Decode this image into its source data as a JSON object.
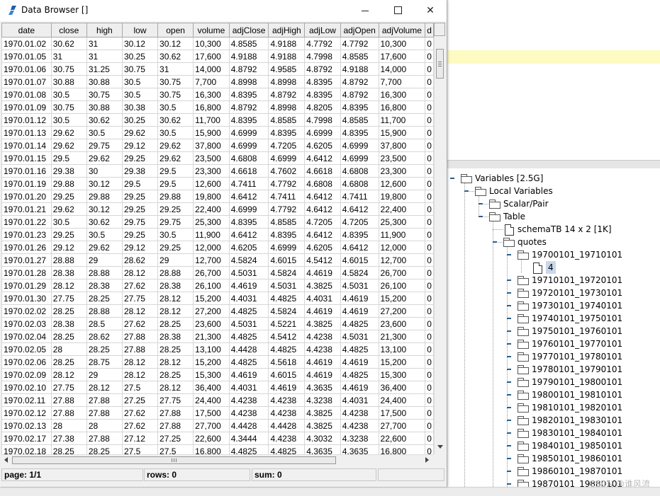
{
  "window": {
    "title": "Data Browser []",
    "minimize_label": "",
    "close_label": "✕"
  },
  "table": {
    "columns": [
      "date",
      "close",
      "high",
      "low",
      "open",
      "volume",
      "adjClose",
      "adjHigh",
      "adjLow",
      "adjOpen",
      "adjVolume",
      "d"
    ],
    "rows": [
      [
        "1970.01.02",
        "30.62",
        "31",
        "30.12",
        "30.12",
        "10,300",
        "4.8585",
        "4.9188",
        "4.7792",
        "4.7792",
        "10,300",
        "0"
      ],
      [
        "1970.01.05",
        "31",
        "31",
        "30.25",
        "30.62",
        "17,600",
        "4.9188",
        "4.9188",
        "4.7998",
        "4.8585",
        "17,600",
        "0"
      ],
      [
        "1970.01.06",
        "30.75",
        "31.25",
        "30.75",
        "31",
        "14,000",
        "4.8792",
        "4.9585",
        "4.8792",
        "4.9188",
        "14,000",
        "0"
      ],
      [
        "1970.01.07",
        "30.88",
        "30.88",
        "30.5",
        "30.75",
        "7,700",
        "4.8998",
        "4.8998",
        "4.8395",
        "4.8792",
        "7,700",
        "0"
      ],
      [
        "1970.01.08",
        "30.5",
        "30.75",
        "30.5",
        "30.75",
        "16,300",
        "4.8395",
        "4.8792",
        "4.8395",
        "4.8792",
        "16,300",
        "0"
      ],
      [
        "1970.01.09",
        "30.75",
        "30.88",
        "30.38",
        "30.5",
        "16,800",
        "4.8792",
        "4.8998",
        "4.8205",
        "4.8395",
        "16,800",
        "0"
      ],
      [
        "1970.01.12",
        "30.5",
        "30.62",
        "30.25",
        "30.62",
        "11,700",
        "4.8395",
        "4.8585",
        "4.7998",
        "4.8585",
        "11,700",
        "0"
      ],
      [
        "1970.01.13",
        "29.62",
        "30.5",
        "29.62",
        "30.5",
        "15,900",
        "4.6999",
        "4.8395",
        "4.6999",
        "4.8395",
        "15,900",
        "0"
      ],
      [
        "1970.01.14",
        "29.62",
        "29.75",
        "29.12",
        "29.62",
        "37,800",
        "4.6999",
        "4.7205",
        "4.6205",
        "4.6999",
        "37,800",
        "0"
      ],
      [
        "1970.01.15",
        "29.5",
        "29.62",
        "29.25",
        "29.62",
        "23,500",
        "4.6808",
        "4.6999",
        "4.6412",
        "4.6999",
        "23,500",
        "0"
      ],
      [
        "1970.01.16",
        "29.38",
        "30",
        "29.38",
        "29.5",
        "23,300",
        "4.6618",
        "4.7602",
        "4.6618",
        "4.6808",
        "23,300",
        "0"
      ],
      [
        "1970.01.19",
        "29.88",
        "30.12",
        "29.5",
        "29.5",
        "12,600",
        "4.7411",
        "4.7792",
        "4.6808",
        "4.6808",
        "12,600",
        "0"
      ],
      [
        "1970.01.20",
        "29.25",
        "29.88",
        "29.25",
        "29.88",
        "19,800",
        "4.6412",
        "4.7411",
        "4.6412",
        "4.7411",
        "19,800",
        "0"
      ],
      [
        "1970.01.21",
        "29.62",
        "30.12",
        "29.25",
        "29.25",
        "22,400",
        "4.6999",
        "4.7792",
        "4.6412",
        "4.6412",
        "22,400",
        "0"
      ],
      [
        "1970.01.22",
        "30.5",
        "30.62",
        "29.75",
        "29.75",
        "25,300",
        "4.8395",
        "4.8585",
        "4.7205",
        "4.7205",
        "25,300",
        "0"
      ],
      [
        "1970.01.23",
        "29.25",
        "30.5",
        "29.25",
        "30.5",
        "11,900",
        "4.6412",
        "4.8395",
        "4.6412",
        "4.8395",
        "11,900",
        "0"
      ],
      [
        "1970.01.26",
        "29.12",
        "29.62",
        "29.12",
        "29.25",
        "12,000",
        "4.6205",
        "4.6999",
        "4.6205",
        "4.6412",
        "12,000",
        "0"
      ],
      [
        "1970.01.27",
        "28.88",
        "29",
        "28.62",
        "29",
        "12,700",
        "4.5824",
        "4.6015",
        "4.5412",
        "4.6015",
        "12,700",
        "0"
      ],
      [
        "1970.01.28",
        "28.38",
        "28.88",
        "28.12",
        "28.88",
        "26,700",
        "4.5031",
        "4.5824",
        "4.4619",
        "4.5824",
        "26,700",
        "0"
      ],
      [
        "1970.01.29",
        "28.12",
        "28.38",
        "27.62",
        "28.38",
        "26,100",
        "4.4619",
        "4.5031",
        "4.3825",
        "4.5031",
        "26,100",
        "0"
      ],
      [
        "1970.01.30",
        "27.75",
        "28.25",
        "27.75",
        "28.12",
        "15,200",
        "4.4031",
        "4.4825",
        "4.4031",
        "4.4619",
        "15,200",
        "0"
      ],
      [
        "1970.02.02",
        "28.25",
        "28.88",
        "28.12",
        "28.12",
        "27,200",
        "4.4825",
        "4.5824",
        "4.4619",
        "4.4619",
        "27,200",
        "0"
      ],
      [
        "1970.02.03",
        "28.38",
        "28.5",
        "27.62",
        "28.25",
        "23,600",
        "4.5031",
        "4.5221",
        "4.3825",
        "4.4825",
        "23,600",
        "0"
      ],
      [
        "1970.02.04",
        "28.25",
        "28.62",
        "27.88",
        "28.38",
        "21,300",
        "4.4825",
        "4.5412",
        "4.4238",
        "4.5031",
        "21,300",
        "0"
      ],
      [
        "1970.02.05",
        "28",
        "28.25",
        "27.88",
        "28.25",
        "13,100",
        "4.4428",
        "4.4825",
        "4.4238",
        "4.4825",
        "13,100",
        "0"
      ],
      [
        "1970.02.06",
        "28.25",
        "28.75",
        "28.12",
        "28.12",
        "15,200",
        "4.4825",
        "4.5618",
        "4.4619",
        "4.4619",
        "15,200",
        "0"
      ],
      [
        "1970.02.09",
        "28.12",
        "29",
        "28.12",
        "28.25",
        "15,300",
        "4.4619",
        "4.6015",
        "4.4619",
        "4.4825",
        "15,300",
        "0"
      ],
      [
        "1970.02.10",
        "27.75",
        "28.12",
        "27.5",
        "28.12",
        "36,400",
        "4.4031",
        "4.4619",
        "4.3635",
        "4.4619",
        "36,400",
        "0"
      ],
      [
        "1970.02.11",
        "27.88",
        "27.88",
        "27.25",
        "27.75",
        "24,400",
        "4.4238",
        "4.4238",
        "4.3238",
        "4.4031",
        "24,400",
        "0"
      ],
      [
        "1970.02.12",
        "27.88",
        "27.88",
        "27.62",
        "27.88",
        "17,500",
        "4.4238",
        "4.4238",
        "4.3825",
        "4.4238",
        "17,500",
        "0"
      ],
      [
        "1970.02.13",
        "28",
        "28",
        "27.62",
        "27.88",
        "27,700",
        "4.4428",
        "4.4428",
        "4.3825",
        "4.4238",
        "27,700",
        "0"
      ],
      [
        "1970.02.17",
        "27.38",
        "27.88",
        "27.12",
        "27.25",
        "22,600",
        "4.3444",
        "4.4238",
        "4.3032",
        "4.3238",
        "22,600",
        "0"
      ],
      [
        "1970.02.18",
        "28.25",
        "28.25",
        "27.5",
        "27.5",
        "16,800",
        "4.4825",
        "4.4825",
        "4.3635",
        "4.3635",
        "16,800",
        "0"
      ]
    ]
  },
  "status": {
    "page": "page: 1/1",
    "rows": "rows: 0",
    "sum": "sum: 0"
  },
  "tree": {
    "root": "Variables [2.5G]",
    "local": "Local Variables",
    "scalar": "Scalar/Pair",
    "table": "Table",
    "schema": "schemaTB 14 x 2 [1K]",
    "quotes": "quotes",
    "open_folder": "19700101_19710101",
    "selected_item": "4",
    "folders": [
      "19710101_19720101",
      "19720101_19730101",
      "19730101_19740101",
      "19740101_19750101",
      "19750101_19760101",
      "19760101_19770101",
      "19770101_19780101",
      "19780101_19790101",
      "19790101_19800101",
      "19800101_19810101",
      "19810101_19820101",
      "19820101_19830101",
      "19830101_19840101",
      "19840101_19850101",
      "19850101_19860101",
      "19860101_19870101",
      "19870101_19880101"
    ]
  },
  "watermark": "CSDN @谁风流",
  "colors": {
    "editor_highlight": "#fdfbc2",
    "tree_toggle": "#2a5e88",
    "selected_tree_item": "#c8d8ec"
  }
}
